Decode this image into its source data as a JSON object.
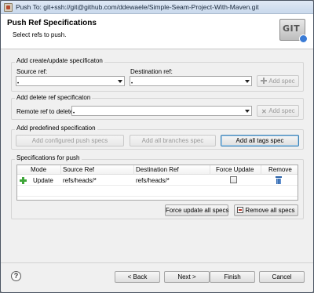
{
  "window": {
    "title": "Push To: git+ssh://git@github.com/ddewaele/Simple-Seam-Project-With-Maven.git"
  },
  "header": {
    "title": "Push Ref Specifications",
    "description": "Select refs to push.",
    "logo_text": "GIT"
  },
  "create_update": {
    "group_label": "Add create/update specificaton",
    "source_label": "Source ref:",
    "destination_label": "Destination ref:",
    "add_button": "Add spec"
  },
  "delete": {
    "group_label": "Add delete ref specificaton",
    "remote_label": "Remote ref to delete:",
    "add_button": "Add spec"
  },
  "predefined": {
    "group_label": "Add predefined specification",
    "configured_button": "Add configured push specs",
    "branches_button": "Add all branches spec",
    "tags_button": "Add all tags spec"
  },
  "specs": {
    "group_label": "Specifications for push",
    "columns": [
      "Mode",
      "Source Ref",
      "Destination Ref",
      "Force Update",
      "Remove"
    ],
    "rows": [
      {
        "mode": "Update",
        "source": "refs/heads/*",
        "destination": "refs/heads/*",
        "force": false
      }
    ],
    "force_all_button": "Force update all specs",
    "remove_all_button": "Remove all specs"
  },
  "footer": {
    "help": "?",
    "back": "< Back",
    "next": "Next >",
    "finish": "Finish",
    "cancel": "Cancel"
  }
}
